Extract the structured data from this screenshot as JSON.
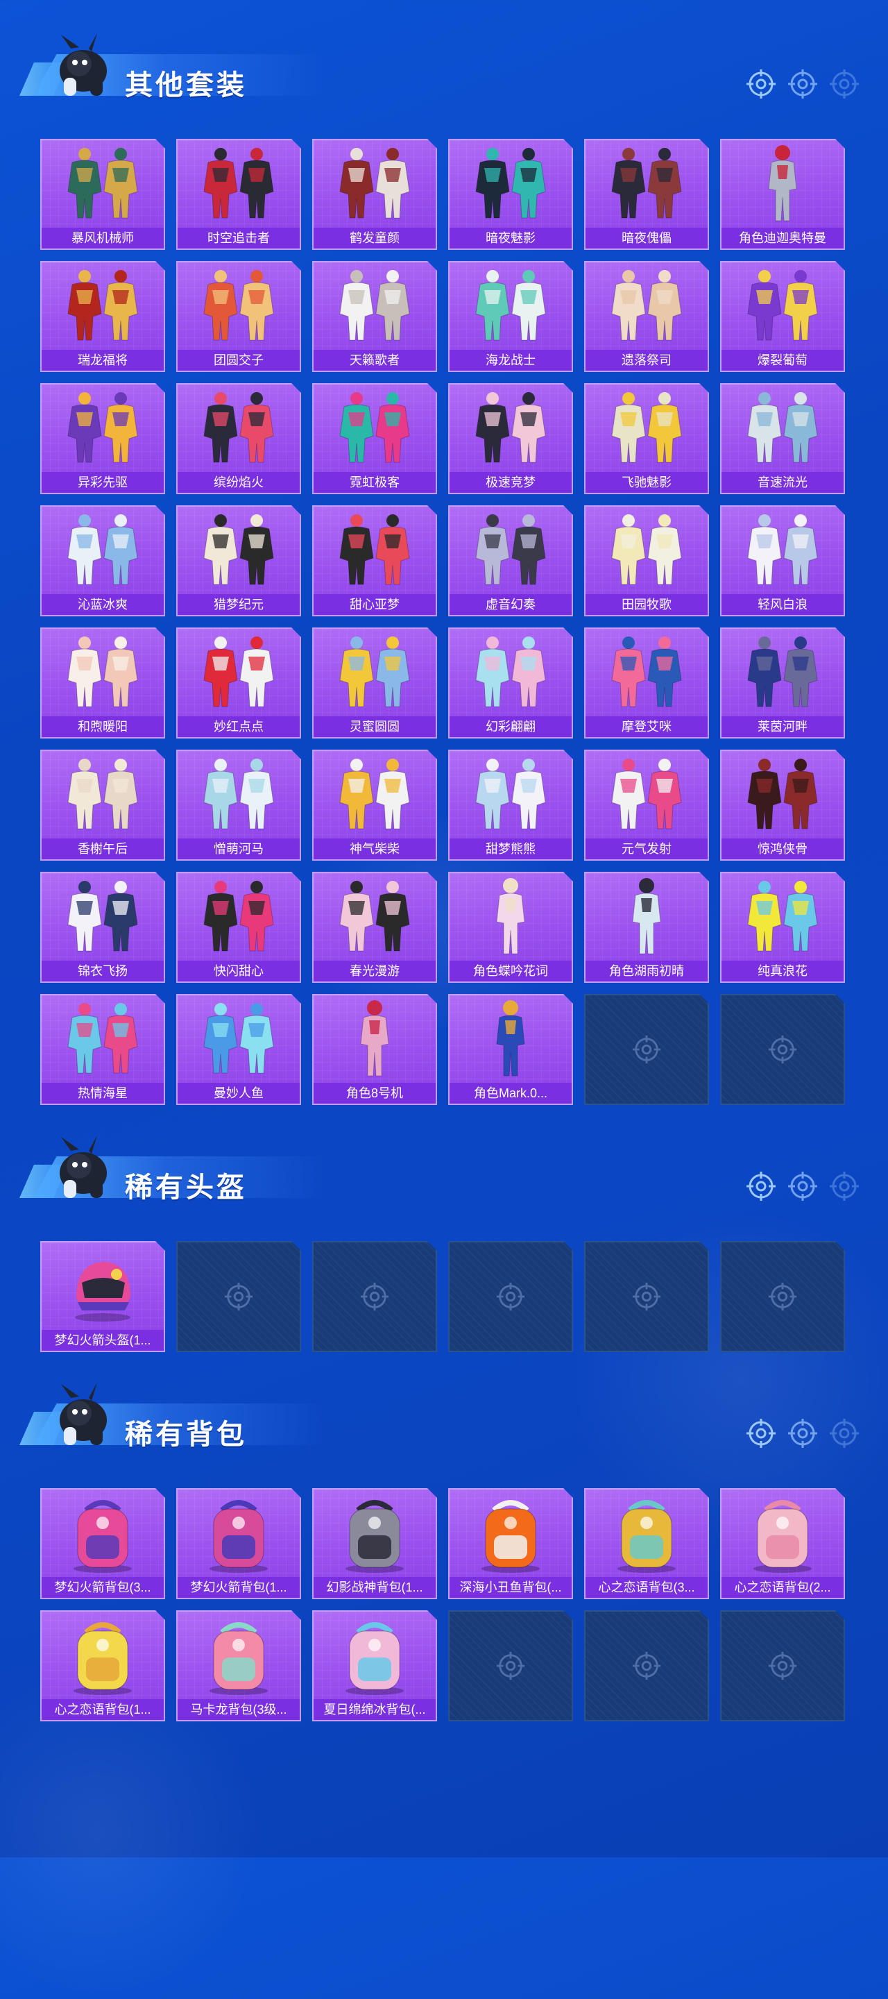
{
  "colors": {
    "background": "#0b47c4",
    "card_purple": "#9b52ef",
    "card_label": "#7a2fe0",
    "card_empty": "#193c78",
    "accent": "#4eaaff"
  },
  "sections": [
    {
      "title": "其他套装",
      "items": [
        {
          "label": "暴风机械师",
          "kind": "outfit-pair",
          "c1": "#2c6b5a",
          "c2": "#d5a84a"
        },
        {
          "label": "时空追击者",
          "kind": "outfit-pair",
          "c1": "#c9283a",
          "c2": "#2a2a33"
        },
        {
          "label": "鹤发童颜",
          "kind": "outfit-pair",
          "c1": "#8a2a2a",
          "c2": "#e8e0d8"
        },
        {
          "label": "暗夜魅影",
          "kind": "outfit-pair",
          "c1": "#1d2a3a",
          "c2": "#2fb7b0"
        },
        {
          "label": "暗夜傀儡",
          "kind": "outfit-pair",
          "c1": "#2a2a3a",
          "c2": "#8a3a3a"
        },
        {
          "label": "角色迪迦奥特曼",
          "kind": "character",
          "c1": "#b0b8c8",
          "c2": "#c8243a"
        },
        {
          "label": "瑞龙福将",
          "kind": "outfit-pair",
          "c1": "#b3261e",
          "c2": "#e8b64a"
        },
        {
          "label": "团圆交子",
          "kind": "outfit-pair",
          "c1": "#e4583a",
          "c2": "#f2c27a"
        },
        {
          "label": "天籁歌者",
          "kind": "outfit-pair",
          "c1": "#f2f2f2",
          "c2": "#c8c0b8"
        },
        {
          "label": "海龙战士",
          "kind": "outfit-pair",
          "c1": "#5fcab8",
          "c2": "#e8f2f0"
        },
        {
          "label": "遗落祭司",
          "kind": "outfit-pair",
          "c1": "#f0dcc8",
          "c2": "#e8c8a8"
        },
        {
          "label": "爆裂葡萄",
          "kind": "outfit-pair",
          "c1": "#7a3ad0",
          "c2": "#f2d04a"
        },
        {
          "label": "异彩先驱",
          "kind": "outfit-pair",
          "c1": "#6a3ab8",
          "c2": "#f2b43a"
        },
        {
          "label": "缤纷焰火",
          "kind": "outfit-pair",
          "c1": "#2a2a3a",
          "c2": "#e84a6a"
        },
        {
          "label": "霓虹极客",
          "kind": "outfit-pair",
          "c1": "#2ab8a8",
          "c2": "#e83a8a"
        },
        {
          "label": "极速竞梦",
          "kind": "outfit-pair",
          "c1": "#2a2a3a",
          "c2": "#f2c8d8"
        },
        {
          "label": "飞驰魅影",
          "kind": "outfit-pair",
          "c1": "#e8e4c8",
          "c2": "#f2c83a"
        },
        {
          "label": "音速流光",
          "kind": "outfit-pair",
          "c1": "#d8e4e8",
          "c2": "#8ab8d8"
        },
        {
          "label": "沁蓝冰爽",
          "kind": "outfit-pair",
          "c1": "#e8f0f8",
          "c2": "#8ab8e8"
        },
        {
          "label": "猎梦纪元",
          "kind": "outfit-pair",
          "c1": "#f2e8d8",
          "c2": "#2a2a2a"
        },
        {
          "label": "甜心亚梦",
          "kind": "outfit-pair",
          "c1": "#2a2a2a",
          "c2": "#e84a5a"
        },
        {
          "label": "虚音幻奏",
          "kind": "outfit-pair",
          "c1": "#b8b8d8",
          "c2": "#3a3a4a"
        },
        {
          "label": "田园牧歌",
          "kind": "outfit-pair",
          "c1": "#f2e8b8",
          "c2": "#f2f0e0"
        },
        {
          "label": "轻风白浪",
          "kind": "outfit-pair",
          "c1": "#f2f2f8",
          "c2": "#b8c8e8"
        },
        {
          "label": "和煦暖阳",
          "kind": "outfit-pair",
          "c1": "#f8f0e8",
          "c2": "#f2c8b8"
        },
        {
          "label": "妙红点点",
          "kind": "outfit-pair",
          "c1": "#e02a3a",
          "c2": "#f2f2f2"
        },
        {
          "label": "灵蜜圆圆",
          "kind": "outfit-pair",
          "c1": "#f2c83a",
          "c2": "#8ab8e8"
        },
        {
          "label": "幻彩翩翩",
          "kind": "outfit-pair",
          "c1": "#a8e0f0",
          "c2": "#f2b8d8"
        },
        {
          "label": "摩登艾咪",
          "kind": "outfit-pair",
          "c1": "#f26a9a",
          "c2": "#2a5ab8"
        },
        {
          "label": "莱茵河畔",
          "kind": "outfit-pair",
          "c1": "#2a3a8a",
          "c2": "#6a6a9a"
        },
        {
          "label": "香榭午后",
          "kind": "outfit-pair",
          "c1": "#f2e8d8",
          "c2": "#e8d8c8"
        },
        {
          "label": "憎萌河马",
          "kind": "outfit-pair",
          "c1": "#a8d8e8",
          "c2": "#e8f2f8"
        },
        {
          "label": "神气柴柴",
          "kind": "outfit-pair",
          "c1": "#f2b83a",
          "c2": "#f2f2f2"
        },
        {
          "label": "甜梦熊熊",
          "kind": "outfit-pair",
          "c1": "#b8d8f0",
          "c2": "#f2f2f8"
        },
        {
          "label": "元气发射",
          "kind": "outfit-pair",
          "c1": "#f2f2f2",
          "c2": "#e84a8a"
        },
        {
          "label": "惊鸿侠骨",
          "kind": "outfit-pair",
          "c1": "#3a1a1a",
          "c2": "#8a2a2a"
        },
        {
          "label": "锦衣飞扬",
          "kind": "outfit-pair",
          "c1": "#f2f2f8",
          "c2": "#2a3a6a"
        },
        {
          "label": "快闪甜心",
          "kind": "outfit-pair",
          "c1": "#2a2a2a",
          "c2": "#e83a7a"
        },
        {
          "label": "春光漫游",
          "kind": "outfit-pair",
          "c1": "#f2c8d8",
          "c2": "#2a2a2a"
        },
        {
          "label": "角色蝶吟花词",
          "kind": "character",
          "c1": "#f2d8e8",
          "c2": "#f0e0c8"
        },
        {
          "label": "角色湖雨初晴",
          "kind": "character",
          "c1": "#d8e8f0",
          "c2": "#2a2a3a"
        },
        {
          "label": "纯真浪花",
          "kind": "outfit-pair",
          "c1": "#f2e83a",
          "c2": "#6ac8e8"
        },
        {
          "label": "热情海星",
          "kind": "outfit-pair",
          "c1": "#6ac8e8",
          "c2": "#e84a8a"
        },
        {
          "label": "曼妙人鱼",
          "kind": "outfit-pair",
          "c1": "#4a9ae8",
          "c2": "#8ae0f0"
        },
        {
          "label": "角色8号机",
          "kind": "character",
          "c1": "#e8a8c8",
          "c2": "#c8284a"
        },
        {
          "label": "角色Mark.0...",
          "kind": "character",
          "c1": "#2a4ab8",
          "c2": "#e8a83a"
        },
        {
          "label": "",
          "kind": "empty"
        },
        {
          "label": "",
          "kind": "empty"
        }
      ]
    },
    {
      "title": "稀有头盔",
      "items": [
        {
          "label": "梦幻火箭头盔(1...",
          "kind": "helmet",
          "c1": "#e84a9a",
          "c2": "#5a3ab8"
        },
        {
          "label": "",
          "kind": "empty"
        },
        {
          "label": "",
          "kind": "empty"
        },
        {
          "label": "",
          "kind": "empty"
        },
        {
          "label": "",
          "kind": "empty"
        },
        {
          "label": "",
          "kind": "empty"
        }
      ]
    },
    {
      "title": "稀有背包",
      "items": [
        {
          "label": "梦幻火箭背包(3...",
          "kind": "backpack",
          "c1": "#e84a9a",
          "c2": "#5a3ab8"
        },
        {
          "label": "梦幻火箭背包(1...",
          "kind": "backpack",
          "c1": "#d84a9a",
          "c2": "#4a3ab8"
        },
        {
          "label": "幻影战神背包(1...",
          "kind": "backpack",
          "c1": "#8a8a9a",
          "c2": "#2a2a3a"
        },
        {
          "label": "深海小丑鱼背包(...",
          "kind": "backpack",
          "c1": "#f26a1a",
          "c2": "#f2f2f2"
        },
        {
          "label": "心之恋语背包(3...",
          "kind": "backpack",
          "c1": "#e8b83a",
          "c2": "#6ac8c8"
        },
        {
          "label": "心之恋语背包(2...",
          "kind": "backpack",
          "c1": "#f2b8c8",
          "c2": "#e88aa8"
        },
        {
          "label": "心之恋语背包(1...",
          "kind": "backpack",
          "c1": "#f2d84a",
          "c2": "#e8a83a"
        },
        {
          "label": "马卡龙背包(3级...",
          "kind": "backpack",
          "c1": "#f28aa8",
          "c2": "#8ad8c8"
        },
        {
          "label": "夏日绵绵冰背包(...",
          "kind": "backpack",
          "c1": "#f2b8d8",
          "c2": "#6ac8e8"
        },
        {
          "label": "",
          "kind": "empty"
        },
        {
          "label": "",
          "kind": "empty"
        },
        {
          "label": "",
          "kind": "empty"
        }
      ]
    }
  ]
}
